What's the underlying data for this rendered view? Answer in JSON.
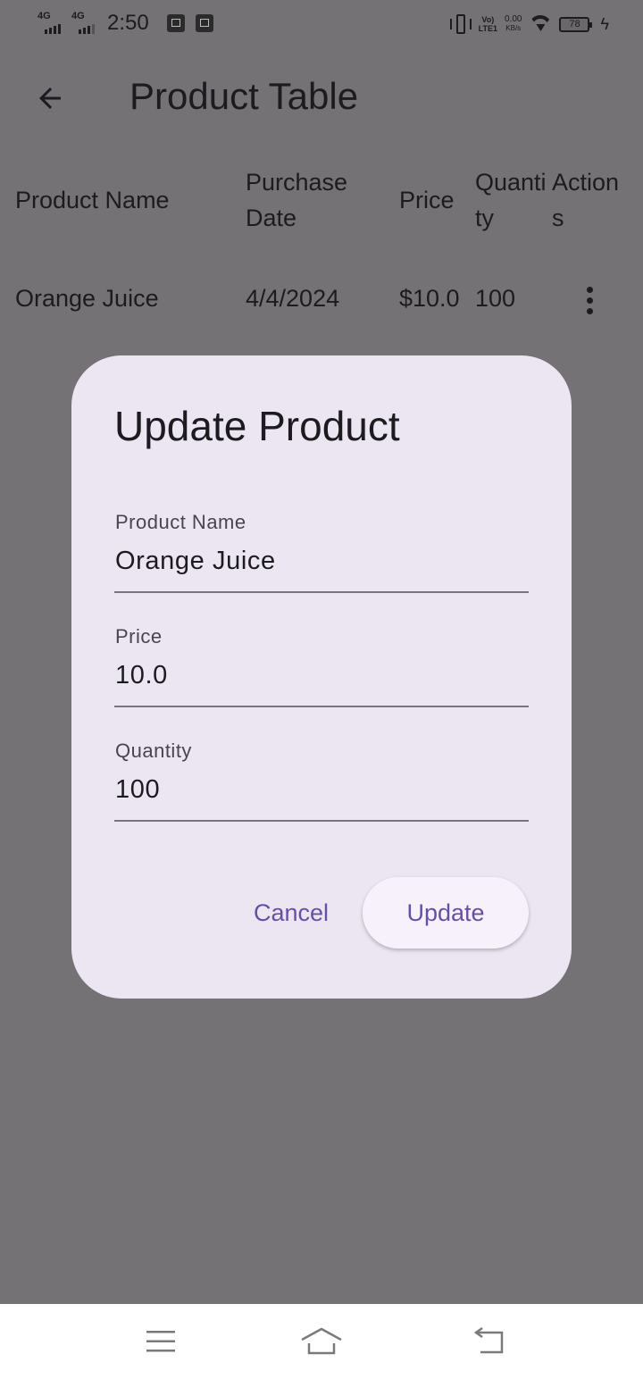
{
  "status_bar": {
    "net1": "4G",
    "net2": "4G",
    "time": "2:50",
    "volte_top": "Vo)",
    "volte_bottom": "LTE1",
    "speed_value": "0.00",
    "speed_unit": "KB/s",
    "battery_level": "78"
  },
  "app_bar": {
    "title": "Product Table"
  },
  "table": {
    "headers": {
      "name": "Product Name",
      "date": "Purchase Date",
      "price": "Price",
      "quantity": "Quantity",
      "actions": "Actions"
    },
    "rows": [
      {
        "name": "Orange Juice",
        "date": "4/4/2024",
        "price": "$10.0",
        "quantity": "100"
      }
    ]
  },
  "dialog": {
    "title": "Update Product",
    "fields": {
      "name": {
        "label": "Product Name",
        "value": "Orange Juice"
      },
      "price": {
        "label": "Price",
        "value": "10.0"
      },
      "quantity": {
        "label": "Quantity",
        "value": "100"
      }
    },
    "cancel_label": "Cancel",
    "update_label": "Update"
  },
  "colors": {
    "scrim_background": "#757275",
    "dialog_surface": "#ece6f3",
    "primary": "#6750a4",
    "on_surface": "#1c1b1f"
  }
}
